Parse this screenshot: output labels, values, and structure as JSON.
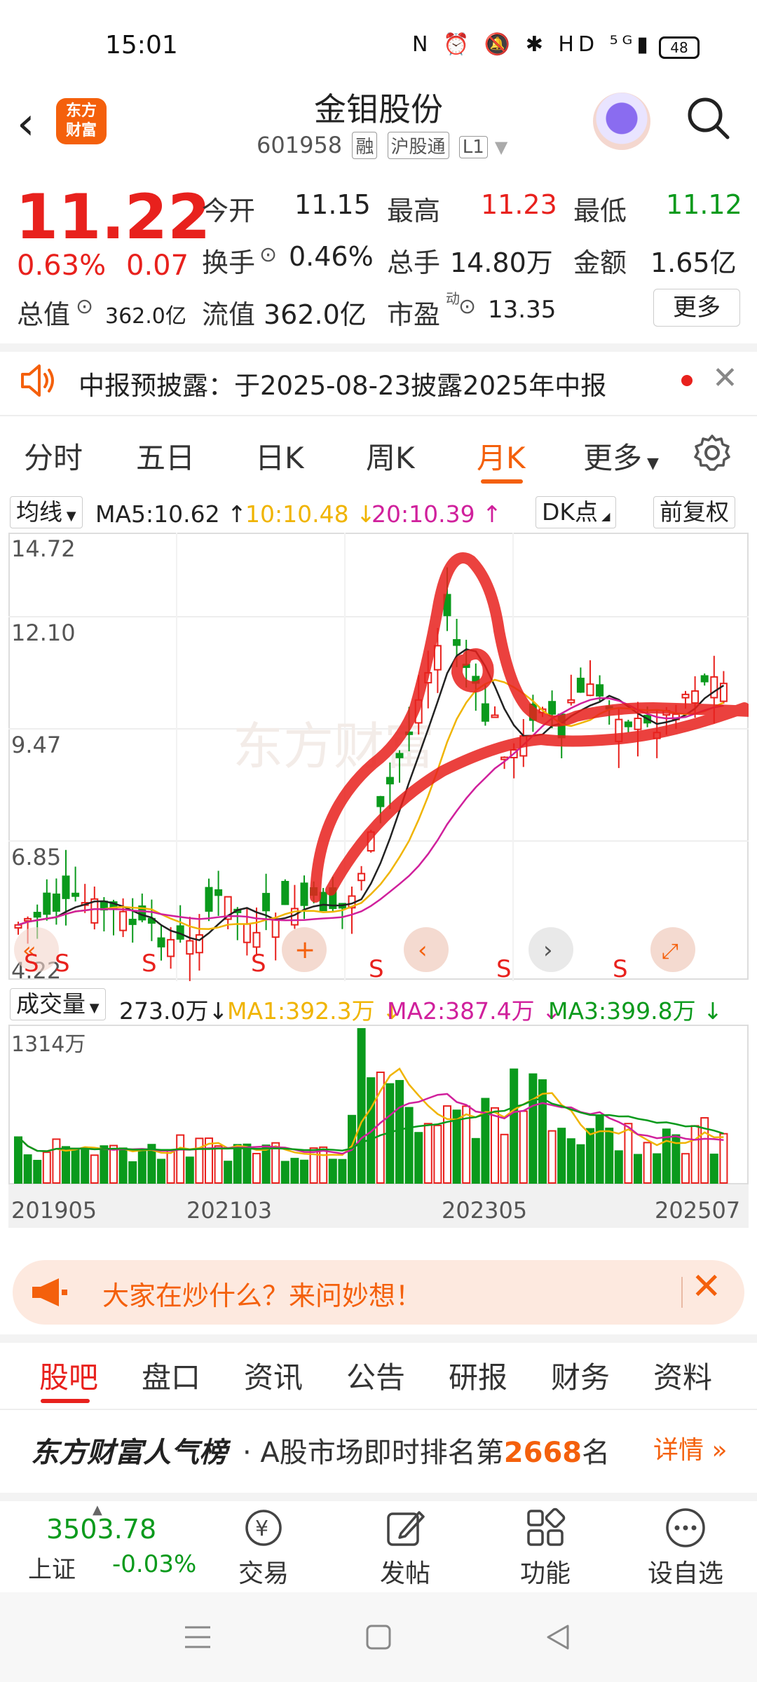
{
  "status_bar": {
    "time": "15:01",
    "icons": "N ⏰ 🔕 ✱ HD ⁵ᴳ▮",
    "battery": "48"
  },
  "header": {
    "logo_text_1": "东方",
    "logo_text_2": "财富",
    "stock_name": "金钼股份",
    "stock_code": "601958",
    "tags": [
      "融",
      "沪股通",
      "L1"
    ]
  },
  "quote": {
    "price": "11.22",
    "change_pct": "0.63%",
    "change_abs": "0.07",
    "open_label": "今开",
    "open": "11.15",
    "high_label": "最高",
    "high": "11.23",
    "low_label": "最低",
    "low": "11.12",
    "turnover_label": "换手",
    "turnover": "0.46%",
    "volume_label": "总手",
    "volume": "14.80万",
    "amount_label": "金额",
    "amount": "1.65亿",
    "mktcap_label": "总值",
    "mktcap": "362.0亿",
    "float_label": "流值",
    "float": "362.0亿",
    "pe_label": "市盈",
    "pe_sup": "动",
    "pe": "13.35",
    "more": "更多"
  },
  "notice": {
    "text": "中报预披露：于2025-08-23披露2025年中报"
  },
  "period_tabs": [
    "分时",
    "五日",
    "日K",
    "周K",
    "月K",
    "更多"
  ],
  "active_period": "月K",
  "ma_bar": {
    "selector": "均线",
    "ma5": "MA5:10.62",
    "ma10": "10:10.48",
    "ma20": "20:10.39",
    "dk": "DK点",
    "adjust": "前复权"
  },
  "kline": {
    "y_ticks": [
      "14.72",
      "12.10",
      "9.47",
      "6.85",
      "4.22"
    ],
    "watermark": "东方财富",
    "signal_labels": [
      "S",
      "S",
      "S",
      "S",
      "S",
      "S",
      "S"
    ]
  },
  "volume_bar": {
    "selector": "成交量",
    "vol": "273.0万",
    "ma1": "MA1:392.3万",
    "ma2": "MA2:387.4万",
    "ma3": "MA3:399.8万",
    "y_max": "1314万"
  },
  "x_ticks": [
    "201905",
    "202103",
    "202305",
    "202507"
  ],
  "banner": {
    "text": "大家在炒什么？来问妙想！"
  },
  "section_tabs": [
    "股吧",
    "盘口",
    "资讯",
    "公告",
    "研报",
    "财务",
    "资料"
  ],
  "ranking": {
    "brand": "东方财富人气榜",
    "text_prefix": "· A股市场即时排名第",
    "rank": "2668",
    "text_suffix": "名",
    "detail": "详情 »"
  },
  "toolbar": {
    "index_value": "3503.78",
    "index_name": "上证",
    "index_change": "-0.03%",
    "items": [
      "交易",
      "发帖",
      "功能",
      "设自选"
    ]
  },
  "colors": {
    "up": "#e8211d",
    "down": "#0a9a1c",
    "accent": "#f4600c",
    "ma5": "#222222",
    "ma10": "#f0b400",
    "ma20": "#d0209c"
  }
}
